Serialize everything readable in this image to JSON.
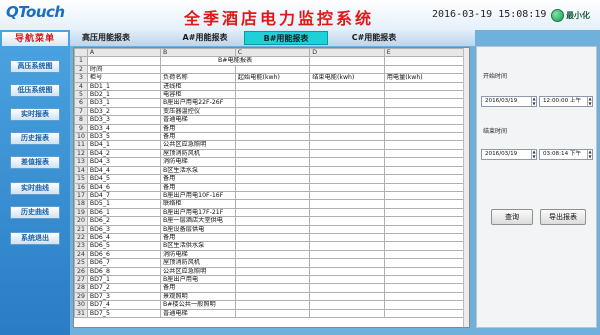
{
  "app": {
    "logo": "QTouch",
    "title": "全季酒店电力监控系统",
    "datetime": "2016-03-19  15:08:19",
    "minimize": "最小化"
  },
  "sidebar": {
    "title": "导航菜单",
    "items": [
      "高压系统图",
      "低压系统图",
      "实时报表",
      "历史报表",
      "差值报表",
      "实时曲线",
      "历史曲线",
      "系统退出"
    ]
  },
  "tabs": [
    "高压用能报表",
    "A#用能报表",
    "B#用能报表",
    "C#用能报表"
  ],
  "sheet": {
    "col_headers": [
      "A",
      "B",
      "C",
      "D",
      "E"
    ],
    "title": "B#电能报表",
    "time_label": "时间",
    "header_row": [
      "柜号",
      "负荷名称",
      "起始电能(kwh)",
      "结束电能(kwh)",
      "用电量(kwh)"
    ],
    "rows": [
      [
        "BD1_1",
        "进线柜"
      ],
      [
        "BD2_1",
        "电容柜"
      ],
      [
        "BD3_1",
        "B座出户用电22F-26F"
      ],
      [
        "BD3_2",
        "变压器温控仪"
      ],
      [
        "BD3_3",
        "普通电梯"
      ],
      [
        "BD3_4",
        "备用"
      ],
      [
        "BD3_5",
        "备用"
      ],
      [
        "BD4_1",
        "公共区应急照明"
      ],
      [
        "BD4_2",
        "屋顶消防风机"
      ],
      [
        "BD4_3",
        "消防电梯"
      ],
      [
        "BD4_4",
        "B区生活水泵"
      ],
      [
        "BD4_5",
        "备用"
      ],
      [
        "BD4_6",
        "备用"
      ],
      [
        "BD4_7",
        "B座出户用电10F-16F"
      ],
      [
        "BD5_1",
        "联络柜"
      ],
      [
        "BD6_1",
        "B座出户用电17F-21F"
      ],
      [
        "BD6_2",
        "B座一层酒店大堂供电"
      ],
      [
        "BD6_3",
        "B座设备层供电"
      ],
      [
        "BD6_4",
        "备用"
      ],
      [
        "BD6_5",
        "B区生活供水泵"
      ],
      [
        "BD6_6",
        "消防电梯"
      ],
      [
        "BD6_7",
        "屋顶消防风机"
      ],
      [
        "BD6_8",
        "公共区应急照明"
      ],
      [
        "BD7_1",
        "B座出户用电"
      ],
      [
        "BD7_2",
        "备用"
      ],
      [
        "BD7_3",
        "景观照明"
      ],
      [
        "BD7_4",
        "B#楼公共一般照明"
      ],
      [
        "BD7_5",
        "普通电梯"
      ]
    ]
  },
  "panel": {
    "start_label": "开始时间",
    "start_date": "2016/03/19",
    "start_time": "12:00:00 上午",
    "end_label": "结束时间",
    "end_date": "2016/03/19",
    "end_time": "03:08:14 下午",
    "query": "查询",
    "export": "导出报表"
  },
  "colors": {
    "title": "#e01818",
    "active_tab": "#1ed0d8",
    "sidebar": "#2a7cc4"
  }
}
